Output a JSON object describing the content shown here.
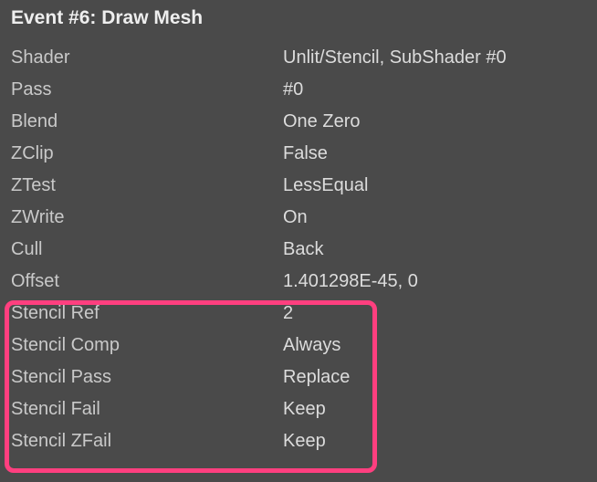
{
  "title": "Event #6: Draw Mesh",
  "rows": [
    {
      "label": "Shader",
      "value": "Unlit/Stencil, SubShader #0"
    },
    {
      "label": "Pass",
      "value": "#0"
    },
    {
      "label": "Blend",
      "value": "One Zero"
    },
    {
      "label": "ZClip",
      "value": "False"
    },
    {
      "label": "ZTest",
      "value": "LessEqual"
    },
    {
      "label": "ZWrite",
      "value": "On"
    },
    {
      "label": "Cull",
      "value": "Back"
    },
    {
      "label": "Offset",
      "value": "1.401298E-45, 0"
    },
    {
      "label": "Stencil Ref",
      "value": "2"
    },
    {
      "label": "Stencil Comp",
      "value": "Always"
    },
    {
      "label": "Stencil Pass",
      "value": "Replace"
    },
    {
      "label": "Stencil Fail",
      "value": "Keep"
    },
    {
      "label": "Stencil ZFail",
      "value": "Keep"
    }
  ]
}
